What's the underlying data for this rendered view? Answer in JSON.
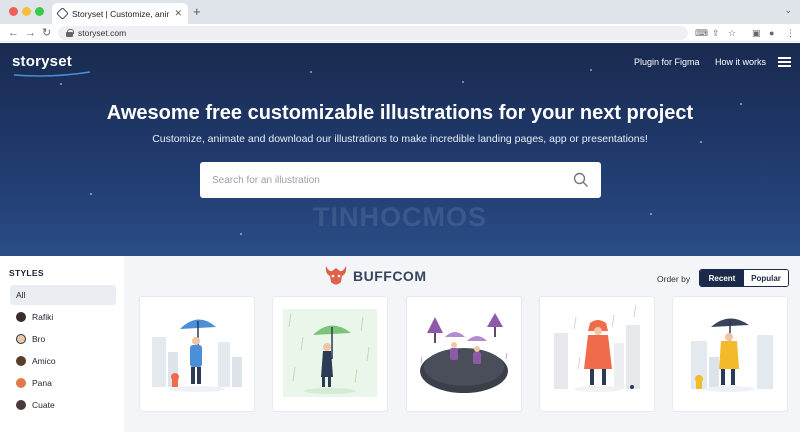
{
  "browser": {
    "tab_title": "Storyset | Customize, animate",
    "tab_close": "✕",
    "new_tab": "+",
    "url": "storyset.com"
  },
  "site": {
    "logo": "storyset",
    "nav": [
      "Plugin for Figma",
      "How it works"
    ]
  },
  "hero": {
    "title": "Awesome free customizable illustrations for your next project",
    "subtitle": "Customize, animate and download our illustrations to make incredible landing pages, app or presentations!",
    "search_placeholder": "Search for an illustration",
    "watermark": "TINHOCMOS"
  },
  "sidebar": {
    "heading": "STYLES",
    "items": [
      {
        "label": "All",
        "active": true
      },
      {
        "label": "Rafiki",
        "active": false
      },
      {
        "label": "Bro",
        "active": false
      },
      {
        "label": "Amico",
        "active": false
      },
      {
        "label": "Pana",
        "active": false
      },
      {
        "label": "Cuate",
        "active": false
      }
    ]
  },
  "overlay_brand": "BUFFCOM",
  "order": {
    "label": "Order by",
    "options": [
      "Recent",
      "Popular"
    ],
    "selected": "Recent"
  },
  "cards": [
    {
      "icon": "rainy-day-umbrella-illustration"
    },
    {
      "icon": "rain-umbrella-woman-illustration"
    },
    {
      "icon": "umbrella-walk-isometric-illustration"
    },
    {
      "icon": "raincoat-woman-illustration"
    },
    {
      "icon": "yellow-raincoat-man-illustration"
    }
  ],
  "colors": {
    "hero_dark": "#192a4f",
    "hero_light": "#2a4d87",
    "accent_blue": "#4a8fd8",
    "accent_green": "#7cc47a",
    "accent_purple": "#8e5aa8",
    "accent_orange": "#ef6b4a",
    "accent_yellow": "#f3bb2c",
    "segment_dark": "#1a2a48"
  }
}
